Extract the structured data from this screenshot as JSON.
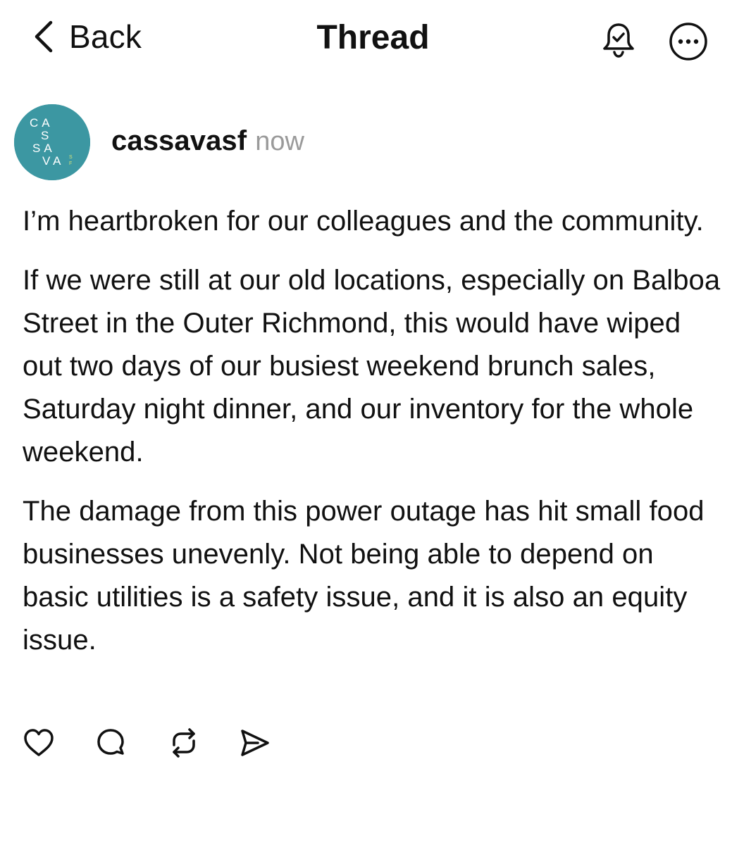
{
  "header": {
    "back_label": "Back",
    "title": "Thread",
    "icons": [
      "chevron-left-icon",
      "bell-check-icon",
      "more-horizontal-icon"
    ]
  },
  "post": {
    "avatar": {
      "letters": [
        "CA",
        "S",
        "SA",
        "VA"
      ],
      "tag": "SF",
      "background": "#3c97a2",
      "accent": "#d6e37a"
    },
    "username": "cassavasf",
    "timestamp": "now",
    "paragraphs": [
      "I’m heartbroken for our colleagues and the community.",
      "If we were still at our old locations, especially on Balboa Street in the Outer Richmond, this would have wiped out two days of our busiest weekend brunch sales, Saturday night dinner, and our inventory for the whole weekend.",
      "The damage from this power outage has hit small food businesses unevenly. Not being able to depend on basic utilities is a safety issue, and it is also an equity issue."
    ],
    "actions": [
      "heart-icon",
      "comment-icon",
      "repost-icon",
      "send-icon"
    ]
  }
}
